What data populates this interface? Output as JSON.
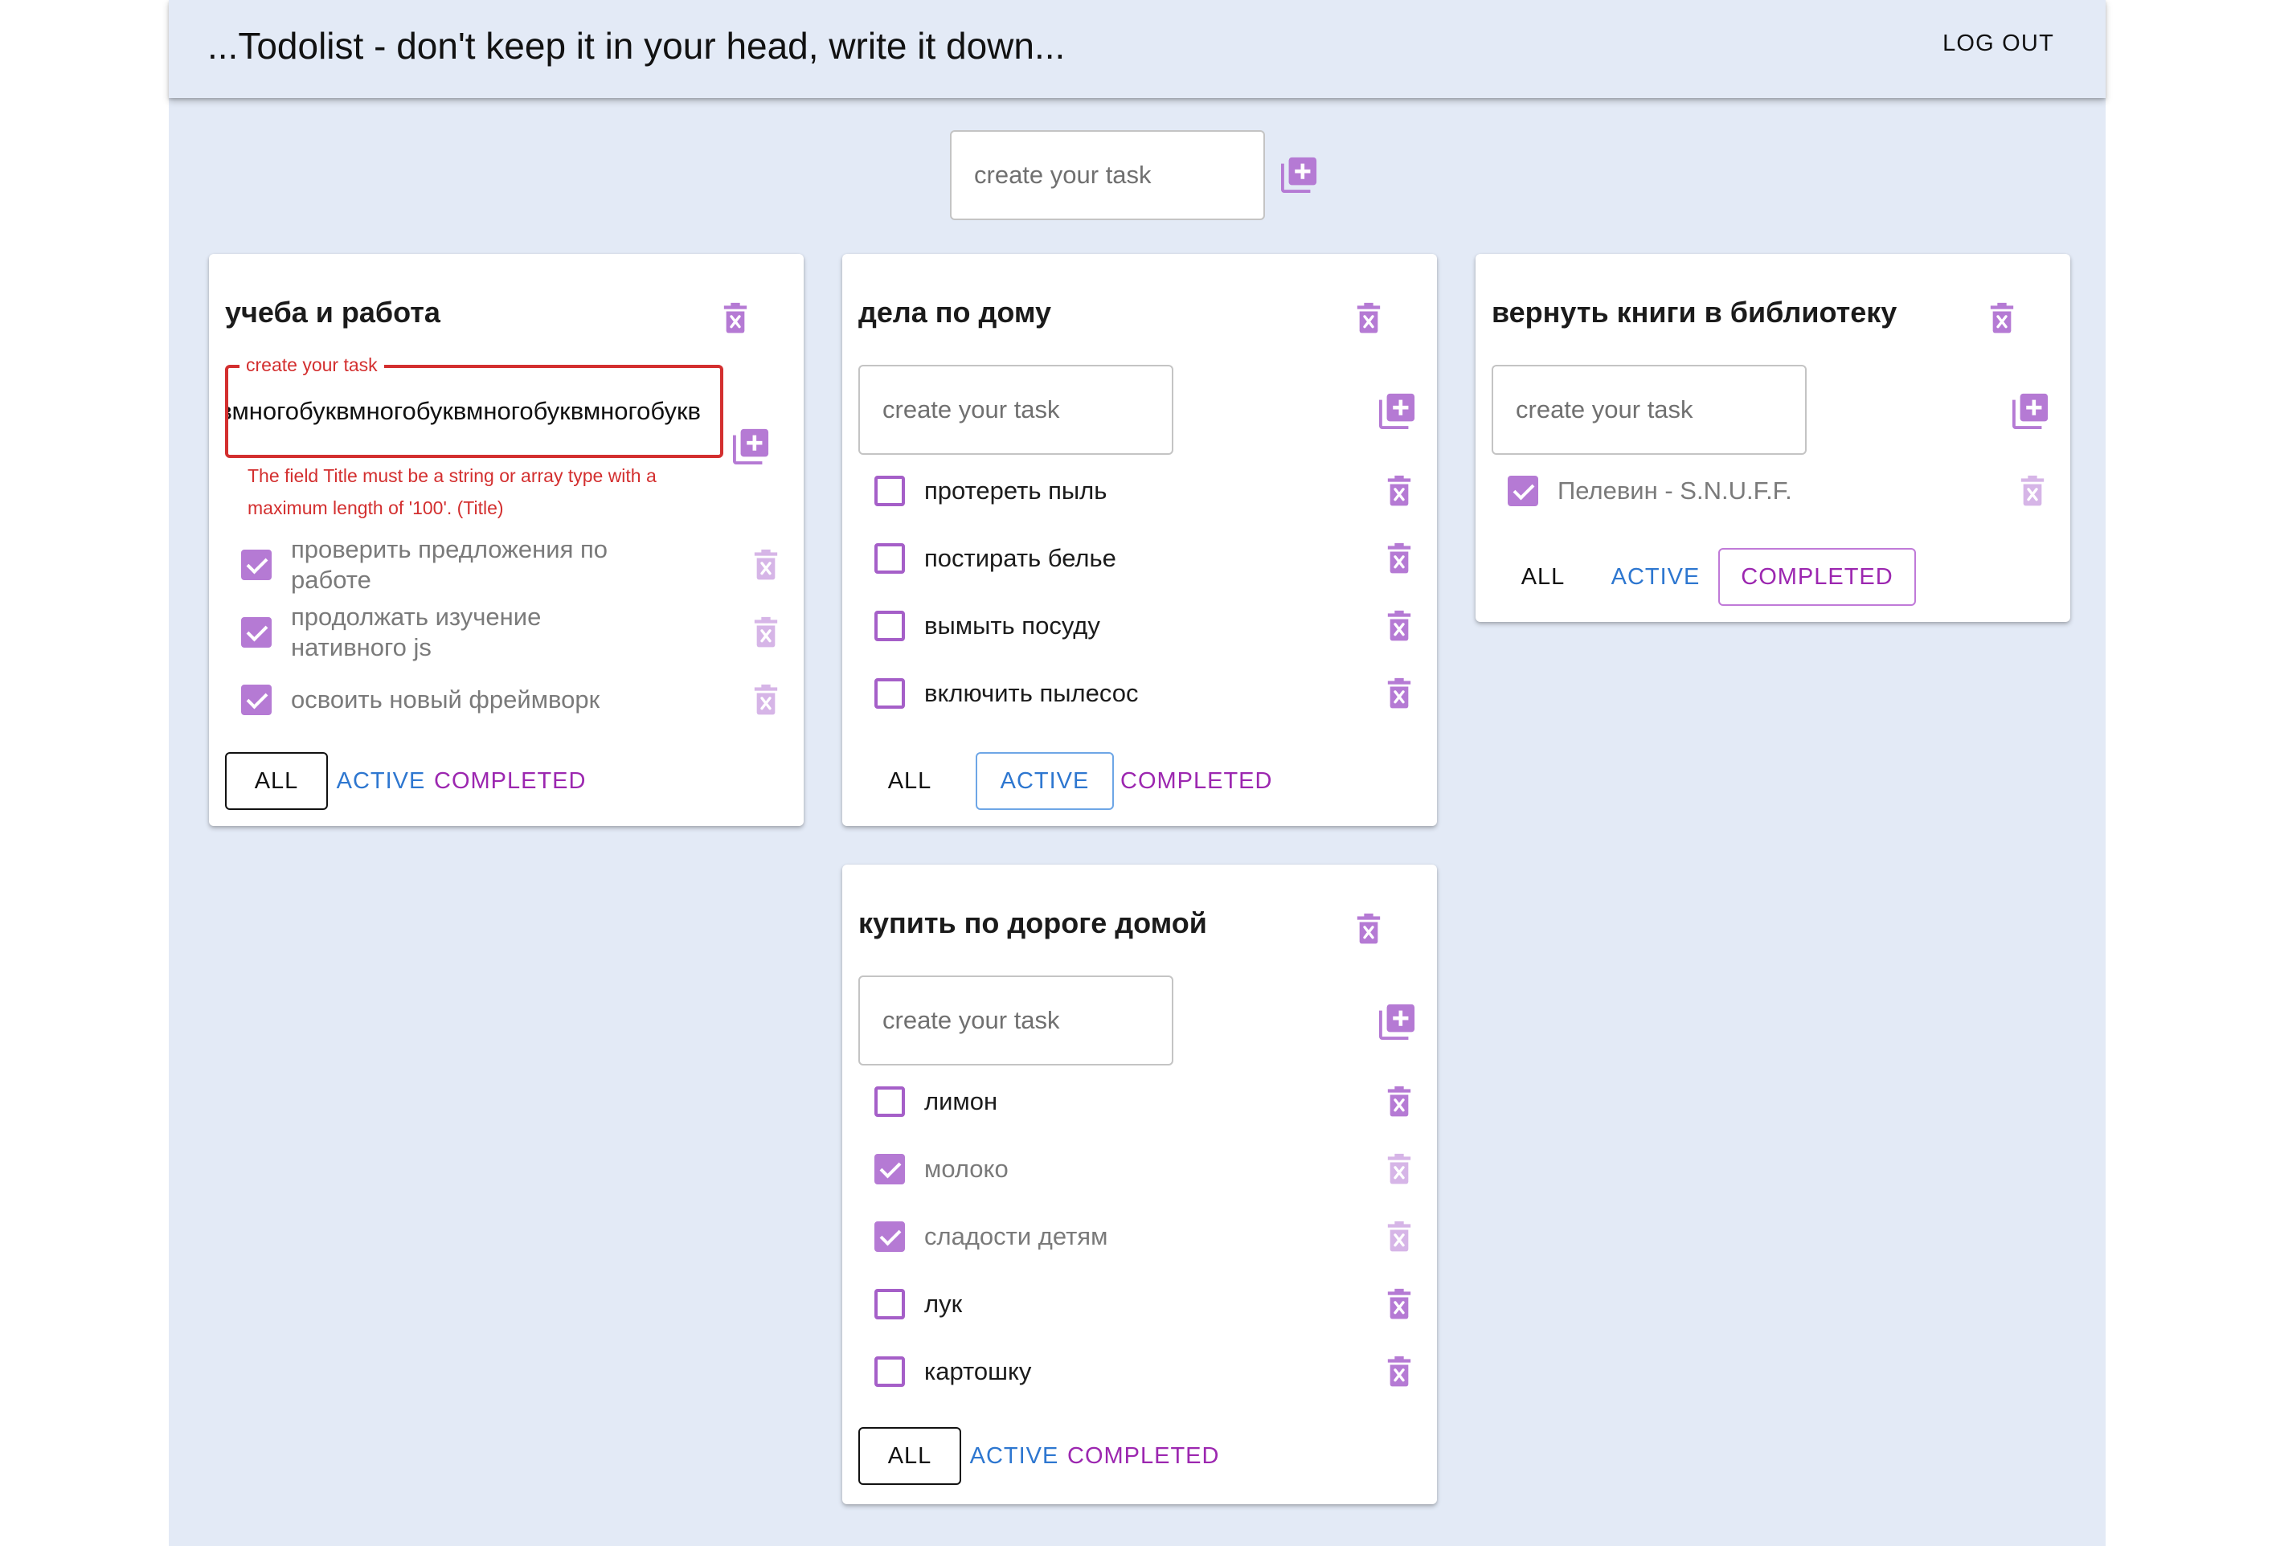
{
  "app": {
    "title": "...Todolist - don't keep it in your head, write it down...",
    "logout_label": "LOG OUT"
  },
  "new_list": {
    "placeholder": "create your task",
    "add_icon": "library-add-icon"
  },
  "colors": {
    "background": "#e3eaf6",
    "accent_purple": "#9c27b0",
    "checkbox_purple": "#b57ad4",
    "active_blue": "#2e77d0",
    "error_red": "#d32f2f"
  },
  "todolists": [
    {
      "title": "учеба и работа",
      "input": {
        "label": "create your task",
        "value": "многобуквмногобуквмногобуквмногобуквмногобуквмногобуквмногобуквмногобуквмногобуквмногобуквмногобукв",
        "error": "The field Title must be a string or array type with a maximum length of '100'. (Title)"
      },
      "tasks": [
        {
          "title": "проверить предложения по работе",
          "done": true
        },
        {
          "title": "продолжать изучение нативного js",
          "done": true
        },
        {
          "title": "освоить новый фреймворк",
          "done": true
        }
      ],
      "filter": "all"
    },
    {
      "title": "дела по дому",
      "input": {
        "placeholder": "create your task"
      },
      "tasks": [
        {
          "title": "протереть пыль",
          "done": false
        },
        {
          "title": "постирать белье",
          "done": false
        },
        {
          "title": "вымыть посуду",
          "done": false
        },
        {
          "title": "включить пылесос",
          "done": false
        }
      ],
      "filter": "active"
    },
    {
      "title": "вернуть книги в библиотеку",
      "input": {
        "placeholder": "create your task"
      },
      "tasks": [
        {
          "title": "Пелевин - S.N.U.F.F.",
          "done": true
        }
      ],
      "filter": "completed"
    },
    {
      "title": "купить по дороге домой",
      "input": {
        "placeholder": "create your task"
      },
      "tasks": [
        {
          "title": "лимон",
          "done": false
        },
        {
          "title": "молоко",
          "done": true
        },
        {
          "title": "сладости детям",
          "done": true
        },
        {
          "title": "лук",
          "done": false
        },
        {
          "title": "картошку",
          "done": false
        }
      ],
      "filter": "all"
    }
  ],
  "filters": {
    "all": "ALL",
    "active": "ACTIVE",
    "completed": "COMPLETED"
  }
}
